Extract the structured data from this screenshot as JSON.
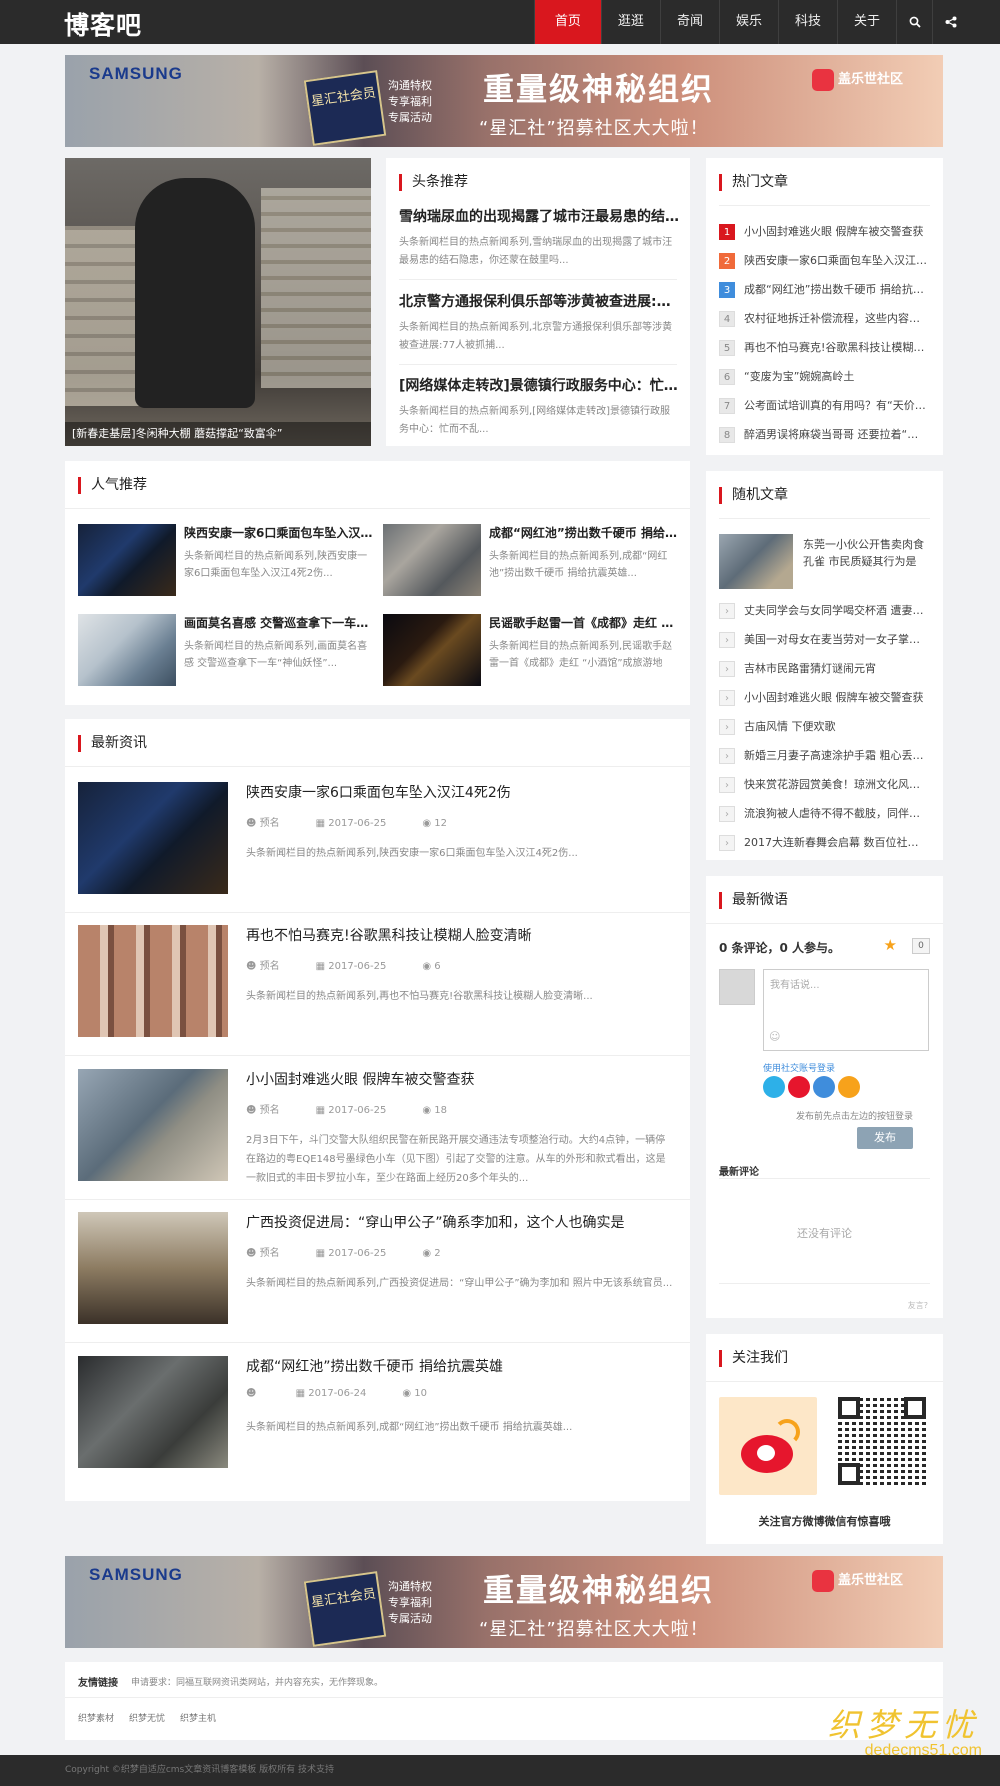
{
  "header": {
    "logo": "博客吧",
    "nav": [
      "首页",
      "逛逛",
      "奇闻",
      "娱乐",
      "科技",
      "关于"
    ],
    "nav_icons": [
      "search-icon",
      "share-icon"
    ]
  },
  "banner": {
    "brand": "SAMSUNG",
    "card": "星汇社会员",
    "perks": [
      "沟通特权",
      "专享福利",
      "专属活动"
    ],
    "headline": "重量级神秘组织",
    "sub": "“星汇社”招募社区大大啦！",
    "community": "盖乐世社区"
  },
  "headlines": {
    "title": "头条推荐",
    "hero_caption": "[新春走基层]冬闲种大棚 蘑菇撑起“致富伞”",
    "items": [
      {
        "title": "雪纳瑞尿血的出现揭露了城市汪最易患的结石隐患",
        "summary": "头条新闻栏目的热点新闻系列,雪纳瑞尿血的出现揭露了城市汪最易患的结石隐患，你还蒙在鼓里吗..."
      },
      {
        "title": "北京警方通报保利俱乐部等涉黄被查进展:77人被抓捕",
        "summary": "头条新闻栏目的热点新闻系列,北京警方通报保利俱乐部等涉黄被查进展:77人被抓捕..."
      },
      {
        "title": "[网络媒体走转改]景德镇行政服务中心：忙而不乱",
        "summary": "头条新闻栏目的热点新闻系列,[网络媒体走转改]景德镇行政服务中心：忙而不乱..."
      }
    ]
  },
  "hot": {
    "title": "热门文章",
    "items": [
      "小小固封难逃火眼 假牌车被交警查获",
      "陕西安康一家6口乘面包车坠入汉江4死2伤",
      "成都“网红池”捞出数千硬币 捐给抗震英雄",
      "农村征地拆迁补偿流程，这些内容请注意",
      "再也不怕马赛克!谷歌黑科技让模糊人脸变清晰",
      "“变废为宝”婉婉高岭土",
      "公考面试培训真的有用吗？有“天价”班",
      "醉酒男误将麻袋当哥哥 还要拉着“它”回家"
    ]
  },
  "popular": {
    "title": "人气推荐",
    "items": [
      {
        "title": "陕西安康一家6口乘面包车坠入汉江4死2伤",
        "summary": "头条新闻栏目的热点新闻系列,陕西安康一家6口乘面包车坠入汉江4死2伤..."
      },
      {
        "title": "成都“网红池”捞出数千硬币 捐给抗震英雄",
        "summary": "头条新闻栏目的热点新闻系列,成都“网红池”捞出数千硬币 捐给抗震英雄..."
      },
      {
        "title": "画面莫名喜感 交警巡查拿下一车“神仙妖怪”",
        "summary": "头条新闻栏目的热点新闻系列,画面莫名喜感 交警巡查拿下一车“神仙妖怪”..."
      },
      {
        "title": "民谣歌手赵雷一首《成都》走红 “小酒馆”成旅游地标",
        "summary": "头条新闻栏目的热点新闻系列,民谣歌手赵雷一首《成都》走红 “小酒馆”成旅游地标..."
      }
    ]
  },
  "latest": {
    "title": "最新资讯",
    "items": [
      {
        "title": "陕西安康一家6口乘面包车坠入汉江4死2伤",
        "author": "预名",
        "date": "2017-06-25",
        "views": "12",
        "summary": "头条新闻栏目的热点新闻系列,陕西安康一家6口乘面包车坠入汉江4死2伤..."
      },
      {
        "title": "再也不怕马赛克!谷歌黑科技让模糊人脸变清晰",
        "author": "预名",
        "date": "2017-06-25",
        "views": "6",
        "summary": "头条新闻栏目的热点新闻系列,再也不怕马赛克!谷歌黑科技让模糊人脸变清晰..."
      },
      {
        "title": "小小固封难逃火眼 假牌车被交警查获",
        "author": "预名",
        "date": "2017-06-25",
        "views": "18",
        "summary": "2月3日下午，斗门交警大队组织民警在新民路开展交通违法专项整治行动。大约4点钟，一辆停在路边的粤EQE148号墨绿色小车（见下图）引起了交警的注意。从车的外形和款式看出，这是一款旧式的丰田卡罗拉小车，至少在路面上经历20多个年头的..."
      },
      {
        "title": "广西投资促进局：“穿山甲公子”确系李加和，这个人也确实是",
        "author": "预名",
        "date": "2017-06-25",
        "views": "2",
        "summary": "头条新闻栏目的热点新闻系列,广西投资促进局：“穿山甲公子”确为李加和 照片中无该系统官员..."
      },
      {
        "title": "成都“网红池”捞出数千硬币 捐给抗震英雄",
        "author": "",
        "date": "2017-06-24",
        "views": "10",
        "summary": "头条新闻栏目的热点新闻系列,成都“网红池”捞出数千硬币 捐给抗震英雄..."
      }
    ]
  },
  "random": {
    "title": "随机文章",
    "feature": "东莞一小伙公开售卖肉食孔雀 市民质疑其行为是",
    "items": [
      "丈夫同学会与女同学喝交杯酒 遭妻子离婚",
      "美国一对母女在麦当劳对一女子掌掴踢打",
      "吉林市民路雷猜灯谜闹元宵",
      "小小固封难逃火眼 假牌车被交警查获",
      "古庙风情 下便欢歌",
      "新婚三月妻子高速涂护手霜 粗心丢了钻戒",
      "快来赏花游园赏美食！琼洲文化风情节开幕",
      "流浪狗被人虐待不得不截肢，同伴的陪伴",
      "2017大连新春舞会启幕 数百位社会名流"
    ]
  },
  "comments": {
    "title": "最新微语",
    "count_text": "0 条评论，0 人参与。",
    "star_count": "0",
    "placeholder": "我有话说...",
    "login_label": "使用社交账号登录",
    "hint": "发布前先点击左边的按钮登录",
    "post_label": "发布",
    "latest_label": "最新评论",
    "empty": "还没有评论",
    "powered": "友言?"
  },
  "follow": {
    "title": "关注我们",
    "caption": "关注官方微博微信有惊喜哦"
  },
  "links": {
    "title": "友情链接",
    "request": "申请要求：同福互联网资讯类网站，并内容充实，无作弊现象。",
    "items": [
      "织梦素材",
      "织梦无忧",
      "织梦主机"
    ]
  },
  "footer": {
    "copyright": "Copyright ©织梦自适应cms文章资讯博客模板 版权所有 技术支持"
  },
  "watermark": {
    "text": "织梦无忧",
    "url": "dedecms51.com"
  }
}
